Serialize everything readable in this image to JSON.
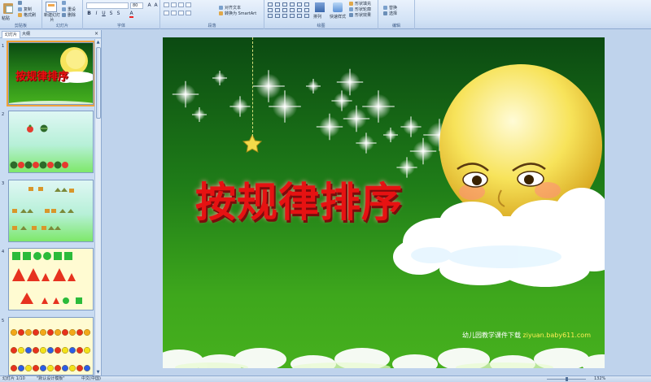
{
  "ribbon": {
    "clipboard": {
      "group_label": "剪贴板",
      "paste_label": "粘贴",
      "cut_label": "",
      "copy_label": "复制",
      "format_painter_label": "格式刷"
    },
    "slides": {
      "group_label": "幻灯片",
      "new_slide_label": "新建幻灯片",
      "layout_label": "",
      "reset_label": "重设",
      "delete_label": "删除"
    },
    "font": {
      "group_label": "字体",
      "font_size_value": "80"
    },
    "paragraph": {
      "group_label": "段落",
      "align_text_label": "对齐文本",
      "convert_smartart_label": "转换为 SmartArt"
    },
    "drawing": {
      "group_label": "绘图",
      "arrange_label": "排列",
      "quick_styles_label": "快速样式",
      "shape_fill_label": "形状填充",
      "shape_outline_label": "形状轮廓",
      "shape_effects_label": "形状效果"
    },
    "editing": {
      "group_label": "编辑",
      "replace_label": "替换",
      "select_label": "选择"
    }
  },
  "panel": {
    "tabs": {
      "slides": "幻灯片",
      "outline": "大纲",
      "close": "×"
    },
    "thumbnails": [
      {
        "number": "1",
        "title": "按规律排序",
        "footer": ""
      },
      {
        "number": "2"
      },
      {
        "number": "3"
      },
      {
        "number": "4"
      },
      {
        "number": "5"
      }
    ]
  },
  "slide": {
    "title": "按规律排序",
    "credit_text": "幼儿园教学课件下载",
    "credit_url": "ziyuan.baby611.com"
  },
  "statusbar": {
    "slide_count": "幻灯片 1/10",
    "theme": "\"默认设计模板\"",
    "language": "中文(中国)",
    "zoom": "132%"
  },
  "colors": {
    "title_red": "#e61212",
    "slide_green_top": "#0b4a12",
    "slide_green_bottom": "#46b01e",
    "ribbon_blue": "#d3e3f6"
  }
}
